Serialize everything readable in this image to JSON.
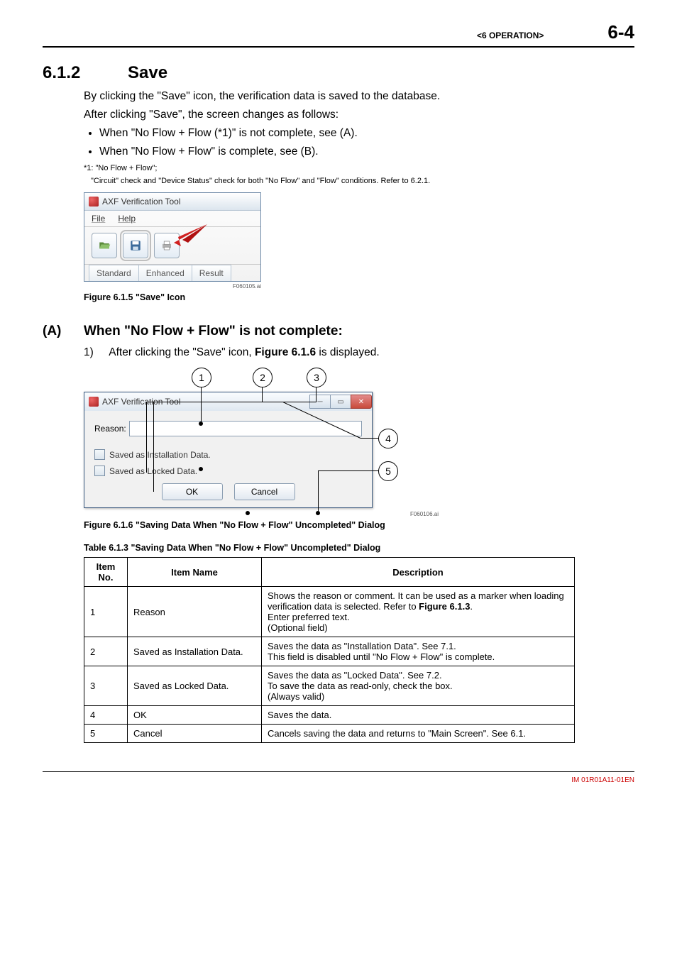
{
  "header": {
    "chapter": "<6  OPERATION>",
    "page": "6-4"
  },
  "s612": {
    "num": "6.1.2",
    "title": "Save",
    "p1": "By clicking the \"Save\" icon, the verification data is saved to the database.",
    "p2": "After clicking \"Save\", the screen changes as follows:",
    "b1": "When \"No Flow + Flow (*1)\" is not complete, see (A).",
    "b2": "When \"No Flow + Flow\" is complete, see (B).",
    "fn1": "*1: \"No Flow + Flow\";",
    "fn2": "\"Circuit\" check and \"Device Status\" check for both \"No Flow\" and \"Flow\" conditions. Refer to 6.2.1."
  },
  "fig1": {
    "title": "AXF Verification Tool",
    "menu": {
      "file": "File",
      "help": "Help"
    },
    "tabs": {
      "t1": "Standard",
      "t2": "Enhanced",
      "t3": "Result"
    },
    "id": "F060105.ai",
    "caption": "Figure 6.1.5 \"Save\" Icon"
  },
  "secA": {
    "lbl": "(A)",
    "title": "When \"No Flow + Flow\" is not complete:",
    "step_n": "1)",
    "step_pre": "After clicking the \"Save\" icon, ",
    "step_bold": "Figure 6.1.6",
    "step_post": " is displayed."
  },
  "fig2": {
    "title": "AXF Verification Tool",
    "reason_label": "Reason:",
    "chk1": "Saved as Installation Data.",
    "chk2": "Saved as Locked Data.",
    "ok": "OK",
    "cancel": "Cancel",
    "callouts": {
      "c1": "1",
      "c2": "2",
      "c3": "3",
      "c4": "4",
      "c5": "5"
    },
    "id": "F060106.ai",
    "caption": "Figure 6.1.6 \"Saving Data When \"No Flow + Flow\" Uncompleted\" Dialog"
  },
  "table": {
    "caption": "Table 6.1.3 \"Saving Data When \"No Flow + Flow\" Uncompleted\" Dialog",
    "head": {
      "c1": "Item No.",
      "c2": "Item Name",
      "c3": "Description"
    },
    "rows": [
      {
        "no": "1",
        "name": "Reason",
        "d1": "Shows the reason or comment. It can be used as a marker when loading verification data is selected. Refer to ",
        "d1b": "Figure 6.1.3",
        "d1p": ".",
        "d2": "Enter preferred text.",
        "d3": "(Optional field)"
      },
      {
        "no": "2",
        "name": "Saved as Installation Data.",
        "d1": "Saves the data as \"Installation Data\". See 7.1.",
        "d2": "This field is disabled until \"No Flow + Flow\" is complete."
      },
      {
        "no": "3",
        "name": "Saved as Locked Data.",
        "d1": "Saves the data as \"Locked Data\". See 7.2.",
        "d2": "To save the data as read-only, check the box.",
        "d3": "(Always valid)"
      },
      {
        "no": "4",
        "name": "OK",
        "d1": "Saves the data."
      },
      {
        "no": "5",
        "name": "Cancel",
        "d1": "Cancels saving the data and returns to \"Main Screen\". See 6.1."
      }
    ]
  },
  "docid": "IM 01R01A11-01EN"
}
